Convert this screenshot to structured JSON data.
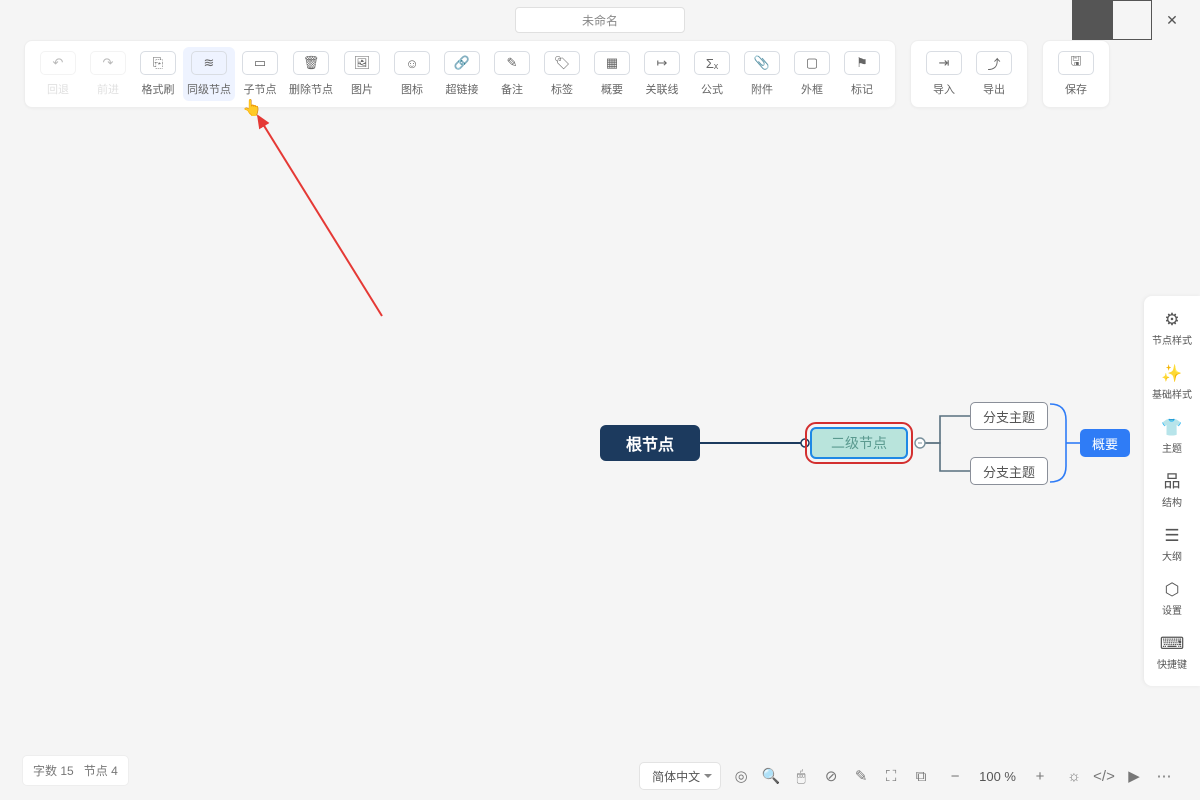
{
  "title": "未命名",
  "toolbar": [
    {
      "icon": "↶",
      "label": "回退",
      "dis": true
    },
    {
      "icon": "↷",
      "label": "前进",
      "dis": true
    },
    {
      "icon": "⎘",
      "label": "格式刷"
    },
    {
      "icon": "≋",
      "label": "同级节点",
      "act": true
    },
    {
      "icon": "▭",
      "label": "子节点"
    },
    {
      "icon": "🗑",
      "label": "删除节点"
    },
    {
      "icon": "🖼",
      "label": "图片"
    },
    {
      "icon": "☺",
      "label": "图标"
    },
    {
      "icon": "🔗",
      "label": "超链接"
    },
    {
      "icon": "✎",
      "label": "备注"
    },
    {
      "icon": "🏷",
      "label": "标签"
    },
    {
      "icon": "▦",
      "label": "概要"
    },
    {
      "icon": "↦",
      "label": "关联线"
    },
    {
      "icon": "Σₓ",
      "label": "公式"
    },
    {
      "icon": "📎",
      "label": "附件"
    },
    {
      "icon": "▢",
      "label": "外框"
    },
    {
      "icon": "⚑",
      "label": "标记"
    }
  ],
  "toolbar2": [
    {
      "icon": "⇥",
      "label": "导入"
    },
    {
      "icon": "⤴",
      "label": "导出"
    }
  ],
  "toolbar3": [
    {
      "icon": "🖫",
      "label": "保存"
    }
  ],
  "nodes": {
    "root": "根节点",
    "second": "二级节点",
    "branch1": "分支主题",
    "branch2": "分支主题",
    "summary": "概要"
  },
  "rpanel": [
    {
      "icon": "⚙",
      "label": "节点样式"
    },
    {
      "icon": "✨",
      "label": "基础样式"
    },
    {
      "icon": "👕",
      "label": "主题"
    },
    {
      "icon": "品",
      "label": "结构"
    },
    {
      "icon": "☰",
      "label": "大纲"
    },
    {
      "icon": "⬡",
      "label": "设置"
    },
    {
      "icon": "⌨",
      "label": "快捷键"
    }
  ],
  "status": {
    "words_label": "字数",
    "words": "15",
    "nodes_label": "节点",
    "nodes": "4"
  },
  "bottom": {
    "lang": "简体中文",
    "zoom": "100 %",
    "icons": [
      "◎",
      "🔍",
      "🖱",
      "⊘",
      "✎",
      "⛶",
      "⧉"
    ],
    "icons2": [
      "☼",
      "</>",
      "▶",
      "⋯"
    ]
  }
}
